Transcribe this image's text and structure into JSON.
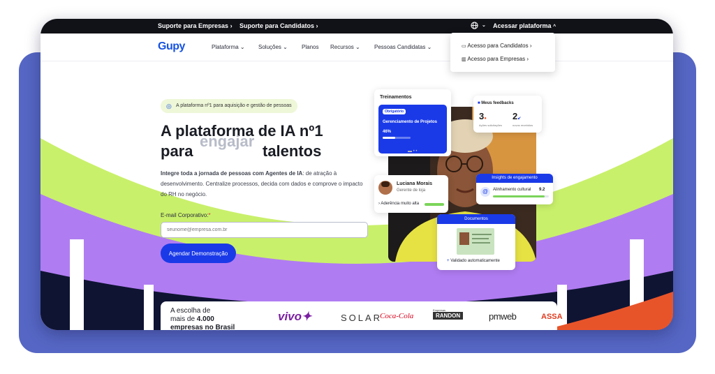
{
  "topbar": {
    "support_companies": "Suporte para Empresas",
    "support_candidates": "Suporte para Candidatos",
    "access_platform": "Acessar plataforma"
  },
  "nav": {
    "logo": "Gupy",
    "items": [
      "Plataforma",
      "Soluções",
      "Planos",
      "Recursos",
      "Pessoas Candidatas"
    ]
  },
  "dropdown": {
    "candidates": "Acesso para Candidatos",
    "companies": "Acesso para Empresas"
  },
  "hero": {
    "badge": "A plataforma nº1 para aquisição e gestão de pessoas",
    "title_line1": "A plataforma de IA nº1",
    "title_for": "para",
    "title_rotating": "engajar",
    "title_end": "talentos",
    "desc_bold": "Integre toda a jornada de pessoas com Agentes de IA",
    "desc_rest": ": de atração à desenvolvimento. Centralize processos, decida com dados e comprove o impacto do RH no negócio.",
    "email_label": "E-mail Corporativo:",
    "required_mark": "*",
    "email_placeholder": "seunome@empresa.com.br",
    "cta": "Agendar Demonstração"
  },
  "cards": {
    "training": {
      "title": "Treinamentos",
      "tag": "Obrigatório",
      "course": "Gerenciamento de Projetos",
      "progress_label": "46%",
      "progress": 0.46
    },
    "feedback": {
      "title": "Meus feedbacks",
      "n1": "3",
      "l1": "Ações solicitações",
      "n2": "2",
      "l2": "novos recebidos"
    },
    "person": {
      "name": "Luciana Morais",
      "role": "Gerente de loja",
      "status": "Aderência muito alta"
    },
    "insights": {
      "title": "Insights de engajamento",
      "metric": "Alinhamento cultural",
      "score": "9.2",
      "fill": 0.92
    },
    "docs": {
      "title": "Documentos",
      "status": "Validado automaticamente"
    }
  },
  "logos": {
    "line1": "A escolha de",
    "line2_prefix": "mais de",
    "line2_bold": "4.000",
    "line3": "empresas no Brasil",
    "brands": [
      "vivo",
      "SOLAR",
      "Coca-Cola",
      "RANDON",
      "pmweb",
      "ASSA"
    ],
    "randon_prefix": "Empresas"
  },
  "colors": {
    "primary": "#1a3ae8",
    "lime": "#c9f06b",
    "purple": "#b07cf2",
    "navy": "#0f1433",
    "backdrop": "#5566c4",
    "orange": "#e8542a"
  }
}
